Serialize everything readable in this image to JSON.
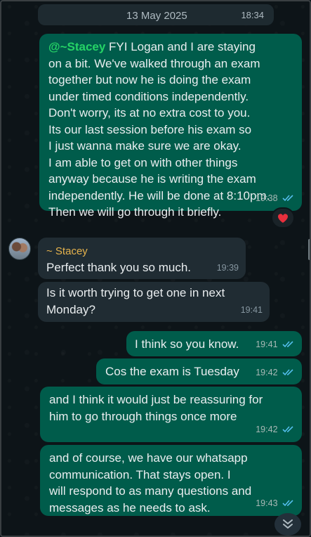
{
  "date_divider": {
    "date": "13 May 2025",
    "time": "18:34"
  },
  "messages": [
    {
      "mention": "@~Stacey",
      "text_after_mention": " FYI Logan and I are staying",
      "lines": [
        "on a bit. We've walked through an exam",
        "together but now he is doing the exam",
        "under timed conditions independently.",
        "Don't worry, its at no extra cost to you.",
        "Its our last session before his exam so",
        "I just wanna make sure we are okay.",
        "I am able to get on with other things",
        "anyway because he is writing the exam",
        "independently. He will be done at 8:10pm.",
        "Then we will go through it briefly."
      ],
      "time": "19:38",
      "reaction": "❤️"
    },
    {
      "sender": "~ Stacey",
      "text": "Perfect thank you so much.",
      "time": "19:39"
    },
    {
      "lines": [
        "Is it worth trying to get one in next",
        "Monday?"
      ],
      "time": "19:41"
    },
    {
      "text": "I think so you know.",
      "time": "19:41"
    },
    {
      "text": "Cos the exam is Tuesday",
      "time": "19:42"
    },
    {
      "lines": [
        "and I think it would just be reassuring for",
        "him to go through things once more"
      ],
      "time": "19:42"
    },
    {
      "lines": [
        "and of course, we have our whatsapp",
        "communication. That stays open. I",
        "will respond to as many questions and",
        "messages as he needs to ask."
      ],
      "time": "19:43"
    }
  ],
  "colors": {
    "outgoing_bubble": "#005c4b",
    "incoming_bubble": "#202c33",
    "mention": "#25d366",
    "sender_name": "#e6b34d",
    "read_ticks": "#53bdeb"
  },
  "icons": {
    "read": "double-check-icon",
    "scroll": "double-chevron-down-icon",
    "reaction": "heart-icon"
  }
}
